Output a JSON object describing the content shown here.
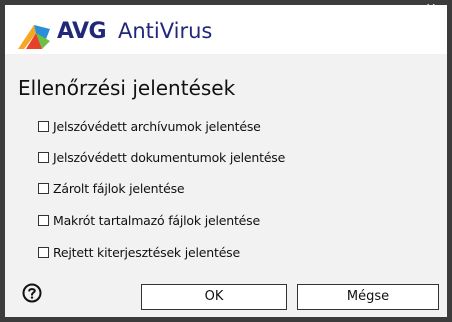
{
  "window": {
    "logo_text": "AVG",
    "product_name": "AntiVirus",
    "close_glyph": "×"
  },
  "dialog": {
    "title": "Ellenőrzési jelentések",
    "options": [
      {
        "label": "Jelszóvédett archívumok jelentése",
        "checked": false
      },
      {
        "label": "Jelszóvédett dokumentumok jelentése",
        "checked": false
      },
      {
        "label": "Zárolt fájlok jelentése",
        "checked": false
      },
      {
        "label": "Makrót tartalmazó fájlok jelentése",
        "checked": false
      },
      {
        "label": "Rejtett kiterjesztések jelentése",
        "checked": false
      }
    ]
  },
  "buttons": {
    "ok_label": "OK",
    "cancel_label": "Mégse"
  },
  "icons": {
    "logo": "avg-logo-icon",
    "help": "help-icon",
    "close": "close-icon"
  },
  "colors": {
    "brand_text": "#21287a",
    "frame": "#3c3c3c"
  }
}
